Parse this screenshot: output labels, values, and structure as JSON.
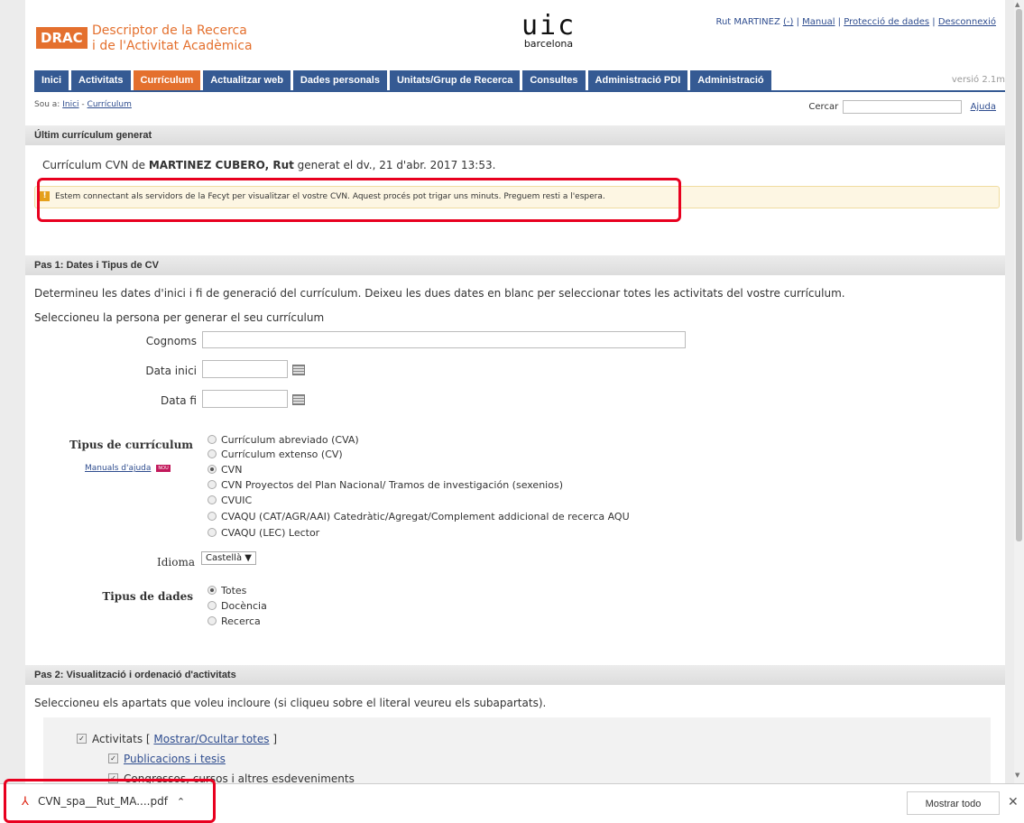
{
  "header": {
    "logo_badge": "DRAC",
    "logo_title_1": "Descriptor de la Recerca",
    "logo_title_2": "i de l'Activitat Acadèmica",
    "uic_big": "uic",
    "uic_small": "barcelona",
    "user": "Rut MARTINEZ",
    "user_action": "(-)",
    "manual": "Manual",
    "privacy": "Protecció de dades",
    "logout": "Desconnexió"
  },
  "nav": {
    "tabs": [
      "Inici",
      "Activitats",
      "Currículum",
      "Actualitzar web",
      "Dades personals",
      "Unitats/Grup de Recerca",
      "Consultes",
      "Administració PDI",
      "Administració"
    ],
    "active": "Currículum",
    "version": "versió 2.1m"
  },
  "breadcrumb": {
    "prefix": "Sou a:",
    "home": "Inici",
    "sep": "-",
    "current": "Currículum"
  },
  "search": {
    "label": "Cercar",
    "value": "",
    "help": "Ajuda"
  },
  "last_cv": {
    "heading": "Últim currículum generat",
    "text_prefix": "Currículum CVN de ",
    "person": "MARTINEZ CUBERO, Rut",
    "text_suffix": " generat el dv., 21 d'abr. 2017 13:53.",
    "alert": "Estem connectant als servidors de la Fecyt per visualitzar el vostre CVN. Aquest procés pot trigar uns minuts. Preguem resti a l'espera."
  },
  "step1": {
    "heading": "Pas 1: Dates i Tipus de CV",
    "intro": "Determineu les dates d'inici i fi de generació del currículum. Deixeu les dues dates en blanc per seleccionar totes les activitats del vostre currículum.",
    "select_person": "Seleccioneu la persona per generar el seu currículum",
    "surnames_label": "Cognoms",
    "start_label": "Data inici",
    "end_label": "Data fi",
    "cv_type_label": "Tipus de currículum",
    "help_link": "Manuals d'ajuda",
    "new_badge": "NOU",
    "cv_types": [
      {
        "label": "Currículum abreviado (CVA)",
        "checked": false
      },
      {
        "label": "Currículum extenso (CV)",
        "checked": false
      },
      {
        "label": "CVN",
        "checked": true
      },
      {
        "label": "CVN Proyectos del Plan Nacional/ Tramos de investigación (sexenios)",
        "checked": false
      },
      {
        "label": "CVUIC",
        "checked": false
      },
      {
        "label": "CVAQU (CAT/AGR/AAI) Catedràtic/Agregat/Complement addicional de recerca AQU",
        "checked": false
      },
      {
        "label": "CVAQU (LEC) Lector",
        "checked": false
      }
    ],
    "language_label": "Idioma",
    "language_value": "Castellà",
    "data_type_label": "Tipus de dades",
    "data_types": [
      {
        "label": "Totes",
        "checked": true
      },
      {
        "label": "Docència",
        "checked": false
      },
      {
        "label": "Recerca",
        "checked": false
      }
    ]
  },
  "step2": {
    "heading": "Pas 2: Visualització i ordenació d'activitats",
    "intro": "Seleccioneu els apartats que voleu incloure (si cliqueu sobre el literal veureu els subapartats).",
    "activities": "Activitats",
    "toggle_all": "Mostrar/Ocultar totes",
    "pubs": "Publicacions i tesis",
    "congress": "Congressos, cursos i altres esdeveniments"
  },
  "downloads": {
    "file": "CVN_spa__Rut_MA....pdf",
    "show_all": "Mostrar todo",
    "close": "✕"
  },
  "colors": {
    "accent": "#e4702e",
    "nav": "#355a93",
    "highlight": "#e8001f"
  }
}
